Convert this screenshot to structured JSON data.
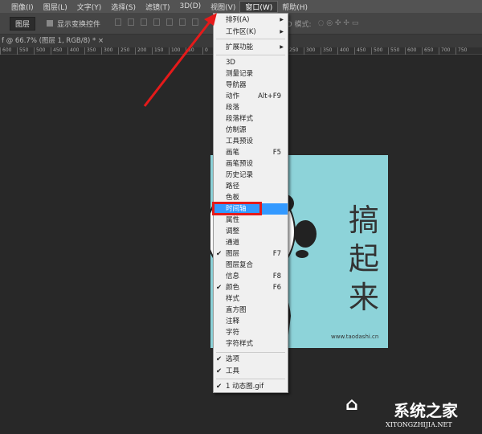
{
  "menubar": {
    "items": [
      "图像(I)",
      "图层(L)",
      "文字(Y)",
      "选择(S)",
      "滤镜(T)",
      "3D(D)",
      "视图(V)",
      "窗口(W)",
      "帮助(H)"
    ],
    "active": "窗口(W)"
  },
  "options": {
    "layer_select": "图层",
    "show_transform": "显示变换控件",
    "mode_3d": "3D 模式:"
  },
  "tab": {
    "title": "f @ 66.7% (图层 1, RGB/8) *",
    "close": "×"
  },
  "ruler": [
    "600",
    "550",
    "500",
    "450",
    "400",
    "350",
    "300",
    "250",
    "200",
    "150",
    "100",
    "50",
    "0",
    "50",
    "100",
    "150",
    "200",
    "250",
    "300",
    "350",
    "400",
    "450",
    "500",
    "550",
    "600",
    "650",
    "700",
    "750"
  ],
  "canvas": {
    "text": [
      "搞",
      "起",
      "来"
    ],
    "url": "www.taodashi.cn",
    "bg": "#8dd3d9"
  },
  "window_menu": {
    "top": [
      {
        "label": "排列(A)",
        "submenu": true
      },
      {
        "label": "工作区(K)",
        "submenu": true
      }
    ],
    "ext": {
      "label": "扩展功能",
      "submenu": true
    },
    "items": [
      {
        "label": "3D"
      },
      {
        "label": "测量记录"
      },
      {
        "label": "导航器"
      },
      {
        "label": "动作",
        "shortcut": "Alt+F9"
      },
      {
        "label": "段落"
      },
      {
        "label": "段落样式"
      },
      {
        "label": "仿制源"
      },
      {
        "label": "工具预设"
      },
      {
        "label": "画笔",
        "shortcut": "F5"
      },
      {
        "label": "画笔预设"
      },
      {
        "label": "历史记录"
      },
      {
        "label": "路径"
      },
      {
        "label": "色板"
      },
      {
        "label": "时间轴",
        "highlighted": true
      },
      {
        "label": "属性"
      },
      {
        "label": "调整"
      },
      {
        "label": "通道"
      },
      {
        "label": "图层",
        "shortcut": "F7",
        "checked": true
      },
      {
        "label": "图层复合"
      },
      {
        "label": "信息",
        "shortcut": "F8"
      },
      {
        "label": "颜色",
        "shortcut": "F6",
        "checked": true
      },
      {
        "label": "样式"
      },
      {
        "label": "直方图"
      },
      {
        "label": "注释"
      },
      {
        "label": "字符"
      },
      {
        "label": "字符样式"
      }
    ],
    "bottom": [
      {
        "label": "选项",
        "checked": true
      },
      {
        "label": "工具",
        "checked": true
      }
    ],
    "docs": [
      {
        "label": "1 动态图.gif",
        "checked": true
      }
    ]
  },
  "watermark": {
    "cn": "系统之家",
    "en": "XITONGZHIJIA.NET"
  },
  "colors": {
    "highlight": "#3399ff",
    "annotation": "#e51a1a"
  }
}
